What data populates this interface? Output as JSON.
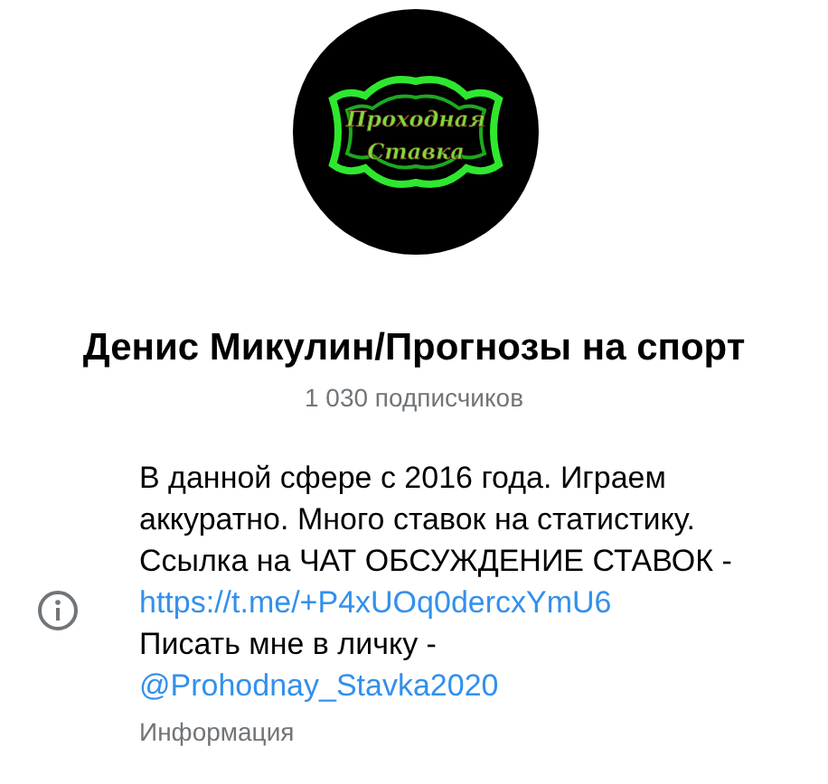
{
  "channel": {
    "logo_lines": [
      "Проходная",
      "Ставка"
    ],
    "name": "Денис Микулин/Прогнозы на спорт",
    "subscribers": "1 030 подписчиков"
  },
  "info": {
    "lines": [
      {
        "kind": "text",
        "text": "В данной сфере с 2016 года. Играем"
      },
      {
        "kind": "text",
        "text": "аккуратно. Много ставок на статистику."
      },
      {
        "kind": "text",
        "text": "Ссылка на ЧАТ ОБСУЖДЕНИЕ СТАВОК -"
      },
      {
        "kind": "link",
        "text": "https://t.me/+P4xUOq0dercxYmU6"
      },
      {
        "kind": "text",
        "text": "Писать мне в личку -"
      },
      {
        "kind": "link",
        "text": "@Prohodnay_Stavka2020"
      }
    ],
    "label": "Информация"
  }
}
